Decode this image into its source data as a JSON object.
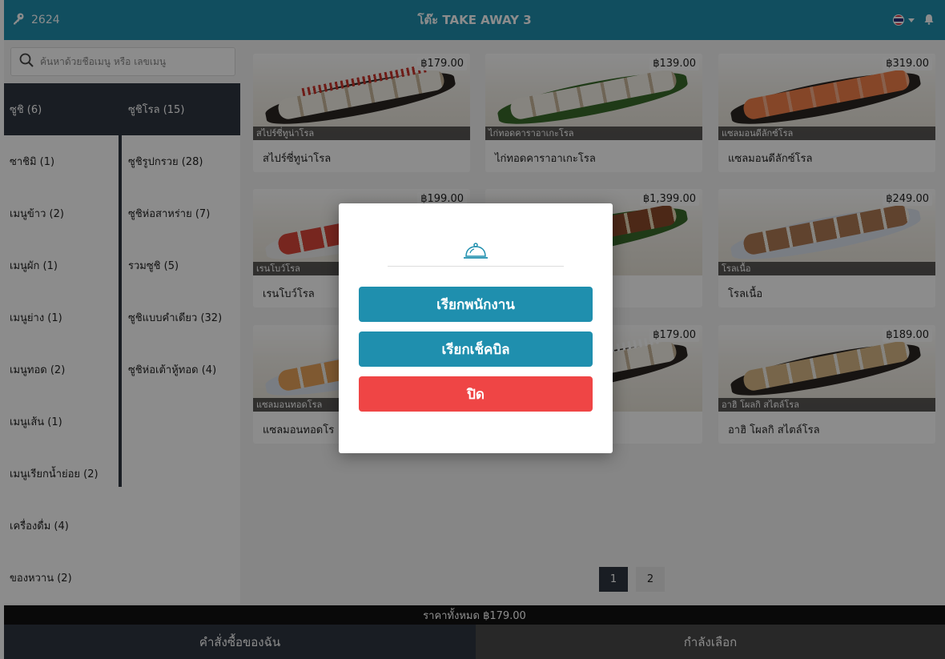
{
  "header": {
    "user_id": "2624",
    "table_title": "โต๊ะ TAKE AWAY 3",
    "language_icon": "thai-flag-icon",
    "icons": [
      "key-icon",
      "thai-flag-icon",
      "chevron-down-icon",
      "bell-icon"
    ]
  },
  "search": {
    "placeholder": "ค้นหาด้วยชื่อเมนู หรือ เลขเมนู"
  },
  "categories": [
    {
      "label": "ซูชิ (6)",
      "active": true
    },
    {
      "label": "ซาชิมิ (1)"
    },
    {
      "label": "เมนูข้าว (2)"
    },
    {
      "label": "เมนูผัก (1)"
    },
    {
      "label": "เมนูย่าง (1)"
    },
    {
      "label": "เมนูทอด (2)"
    },
    {
      "label": "เมนูเส้น (1)"
    },
    {
      "label": "เมนูเรียกน้ำย่อย (2)"
    },
    {
      "label": "เครื่องดื่ม (4)"
    },
    {
      "label": "ของหวาน (2)"
    }
  ],
  "subcategories": [
    {
      "label": "ซูชิโรล (15)",
      "active": true
    },
    {
      "label": "ซูชิรูปกรวย (28)"
    },
    {
      "label": "ซูชิห่อสาหร่าย (7)"
    },
    {
      "label": "รวมซูชิ (5)"
    },
    {
      "label": "ซูชิแบบคำเดียว (32)"
    },
    {
      "label": "ซูชิห่อเต้าหู้ทอด (4)"
    }
  ],
  "products": [
    {
      "price": "฿179.00",
      "caption": "สไปร์ซี่ทูน่าโรล",
      "name": "สไปร์ซี่ทูน่าโรล"
    },
    {
      "price": "฿139.00",
      "caption": "ไก่ทอดคาราอาเกะโรล",
      "name": "ไก่ทอดคาราอาเกะโรล"
    },
    {
      "price": "฿319.00",
      "caption": "แซลมอนดีลักซ์โรล",
      "name": "แซลมอนดีลักซ์โรล"
    },
    {
      "price": "฿199.00",
      "caption": "เรนโบว์โรล",
      "name": "เรนโบว์โรล"
    },
    {
      "price": "฿1,399.00",
      "caption": "",
      "name": ""
    },
    {
      "price": "฿249.00",
      "caption": "โรลเนื้อ",
      "name": "โรลเนื้อ"
    },
    {
      "price": "",
      "caption": "แซลมอนทอดโรล",
      "name": "แซลมอนทอดโร"
    },
    {
      "price": "฿179.00",
      "caption": "",
      "name": ""
    },
    {
      "price": "฿189.00",
      "caption": "อาฮิ โผลกิ สไตล์โรล",
      "name": "อาฮิ โผลกิ สไตล์โรล"
    }
  ],
  "pagination": {
    "pages": [
      "1",
      "2"
    ],
    "current": "1"
  },
  "footer": {
    "total": "ราคาทั้งหมด ฿179.00",
    "tab_orders": "คำสั่งซื้อของฉัน",
    "tab_selecting": "กำลังเลือก"
  },
  "modal": {
    "icon": "service-bell-icon",
    "call_staff": "เรียกพนักงาน",
    "call_bill": "เรียกเช็คบิล",
    "close": "ปิด"
  },
  "colors": {
    "primary": "#1f8fae",
    "dark": "#2e3540",
    "danger": "#ef4545"
  }
}
